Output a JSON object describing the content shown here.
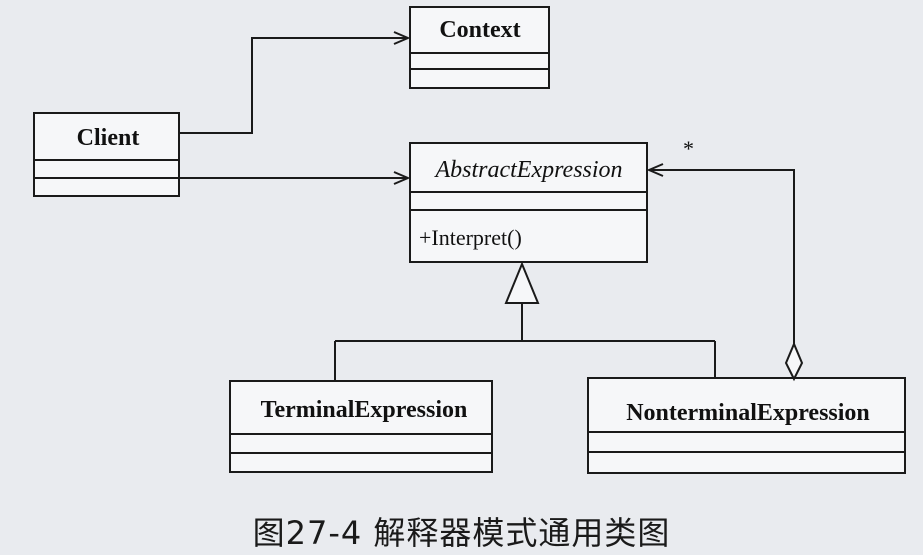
{
  "diagram": {
    "classes": {
      "context": {
        "name": "Context"
      },
      "client": {
        "name": "Client"
      },
      "abstract_expression": {
        "name": "AbstractExpression",
        "operation": "+Interpret()"
      },
      "terminal_expression": {
        "name": "TerminalExpression"
      },
      "nonterminal_expression": {
        "name": "NonterminalExpression"
      }
    },
    "aggregation_multiplicity": "*"
  },
  "caption": "图27-4   解释器模式通用类图"
}
